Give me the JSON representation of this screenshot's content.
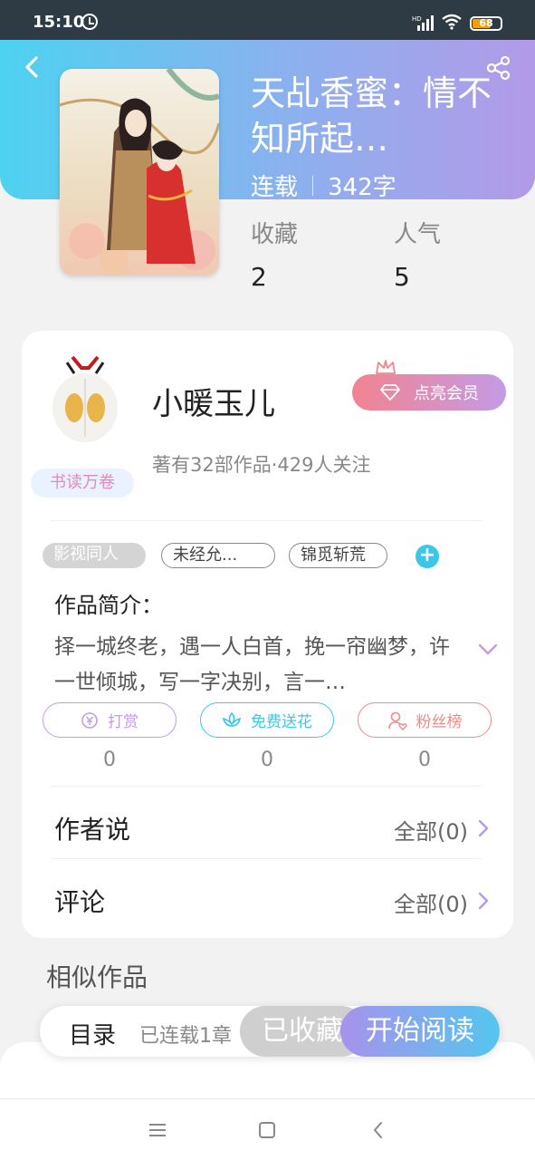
{
  "status_bar": {
    "time": "15:10",
    "battery_level": "68",
    "battery_fraction": 0.68,
    "icons": [
      "alarm-icon",
      "signal-icon",
      "wifi-icon",
      "battery-icon"
    ]
  },
  "header": {
    "back_icon": "chevron-left-icon",
    "share_icon": "share-icon",
    "title": "天乩香蜜：情不知所起…",
    "status": "连载",
    "word_count": "342字"
  },
  "stats": [
    {
      "label": "收藏",
      "value": "2"
    },
    {
      "label": "人气",
      "value": "5"
    }
  ],
  "author": {
    "name": "小暖玉儿",
    "stats": "著有32部作品·429人关注",
    "badge": "书读万卷",
    "vip_button": "点亮会员"
  },
  "tags": [
    "影视同人",
    "未经允...",
    "锦觅斩荒"
  ],
  "intro": {
    "heading": "作品简介：",
    "text": "择一城终老，遇一人白首，挽一帘幽梦，许一世倾城，写一字决别，言一…"
  },
  "actions": [
    {
      "label": "打赏",
      "count": "0",
      "icon": "yen-coin-icon",
      "color": "#c59ae3"
    },
    {
      "label": "免费送花",
      "count": "0",
      "icon": "flower-icon",
      "color": "#3bc7ea"
    },
    {
      "label": "粉丝榜",
      "count": "0",
      "icon": "fan-user-icon",
      "color": "#ef8a87"
    }
  ],
  "rows": {
    "author_says": {
      "title": "作者说",
      "link": "全部(0)"
    },
    "comments": {
      "title": "评论",
      "link": "全部(0)"
    }
  },
  "similar": {
    "heading": "相似作品"
  },
  "bottom_bar": {
    "catalog_label": "目录",
    "catalog_count": "已连载1章",
    "collected_label": "已收藏",
    "read_label": "开始阅读"
  },
  "colors": {
    "accent_purple": "#b39ae8",
    "accent_cyan": "#4dd2f0",
    "vip_pink": "#f2838f"
  }
}
